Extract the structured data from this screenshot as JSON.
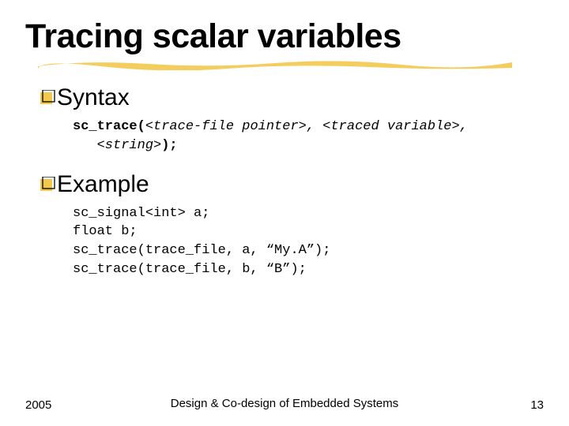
{
  "title": "Tracing scalar variables",
  "bullets": {
    "syntax": {
      "label": "Syntax",
      "code_fn": "sc_trace(",
      "code_args": "<trace-file pointer>, <traced variable>,\n   <string>",
      "code_tail": ");"
    },
    "example": {
      "label": "Example",
      "code": "sc_signal<int> a;\nfloat b;\nsc_trace(trace_file, a, “My.A”);\nsc_trace(trace_file, b, “B”);"
    }
  },
  "footer": {
    "year": "2005",
    "center": "Design & Co-design of Embedded\nSystems",
    "page": "13"
  },
  "colors": {
    "accent": "#f2c94c"
  }
}
